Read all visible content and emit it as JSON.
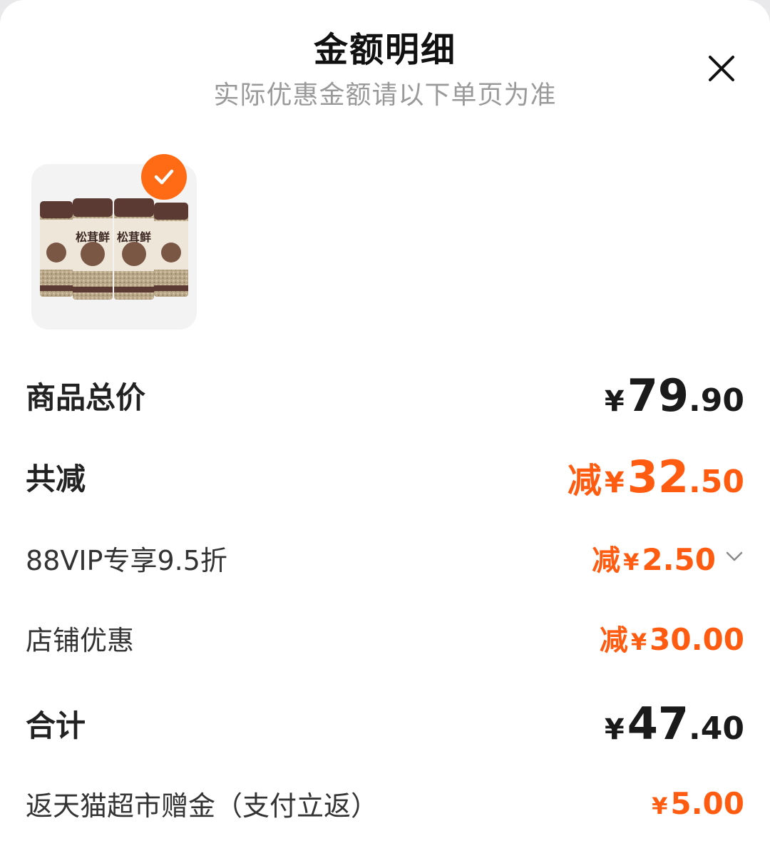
{
  "header": {
    "title": "金额明细",
    "subtitle": "实际优惠金额请以下单页为准",
    "close_icon": "close-icon"
  },
  "product": {
    "image_text": "松茸鲜",
    "selected": true,
    "check_icon": "check-icon"
  },
  "rows": {
    "subtotal": {
      "label": "商品总价",
      "yen": "¥",
      "int": "79",
      "dec": ".90"
    },
    "discount_total": {
      "label": "共减",
      "prefix": "减",
      "yen": "¥",
      "int": "32",
      "dec": ".50"
    },
    "vip": {
      "label": "88VIP专享9.5折",
      "prefix": "减",
      "yen": "¥",
      "int": "2",
      "dec": ".50",
      "icon": "chevron-down-icon"
    },
    "shop": {
      "label": "店铺优惠",
      "prefix": "减",
      "yen": "¥",
      "int": "30",
      "dec": ".00"
    },
    "total": {
      "label": "合计",
      "yen": "¥",
      "int": "47",
      "dec": ".40"
    },
    "cashback": {
      "label": "返天猫超市赠金（支付立返）",
      "yen": "¥",
      "int": "5",
      "dec": ".00"
    }
  },
  "colors": {
    "accent": "#ff5c12",
    "text": "#1a1a1a",
    "muted": "#9a9a9a"
  }
}
